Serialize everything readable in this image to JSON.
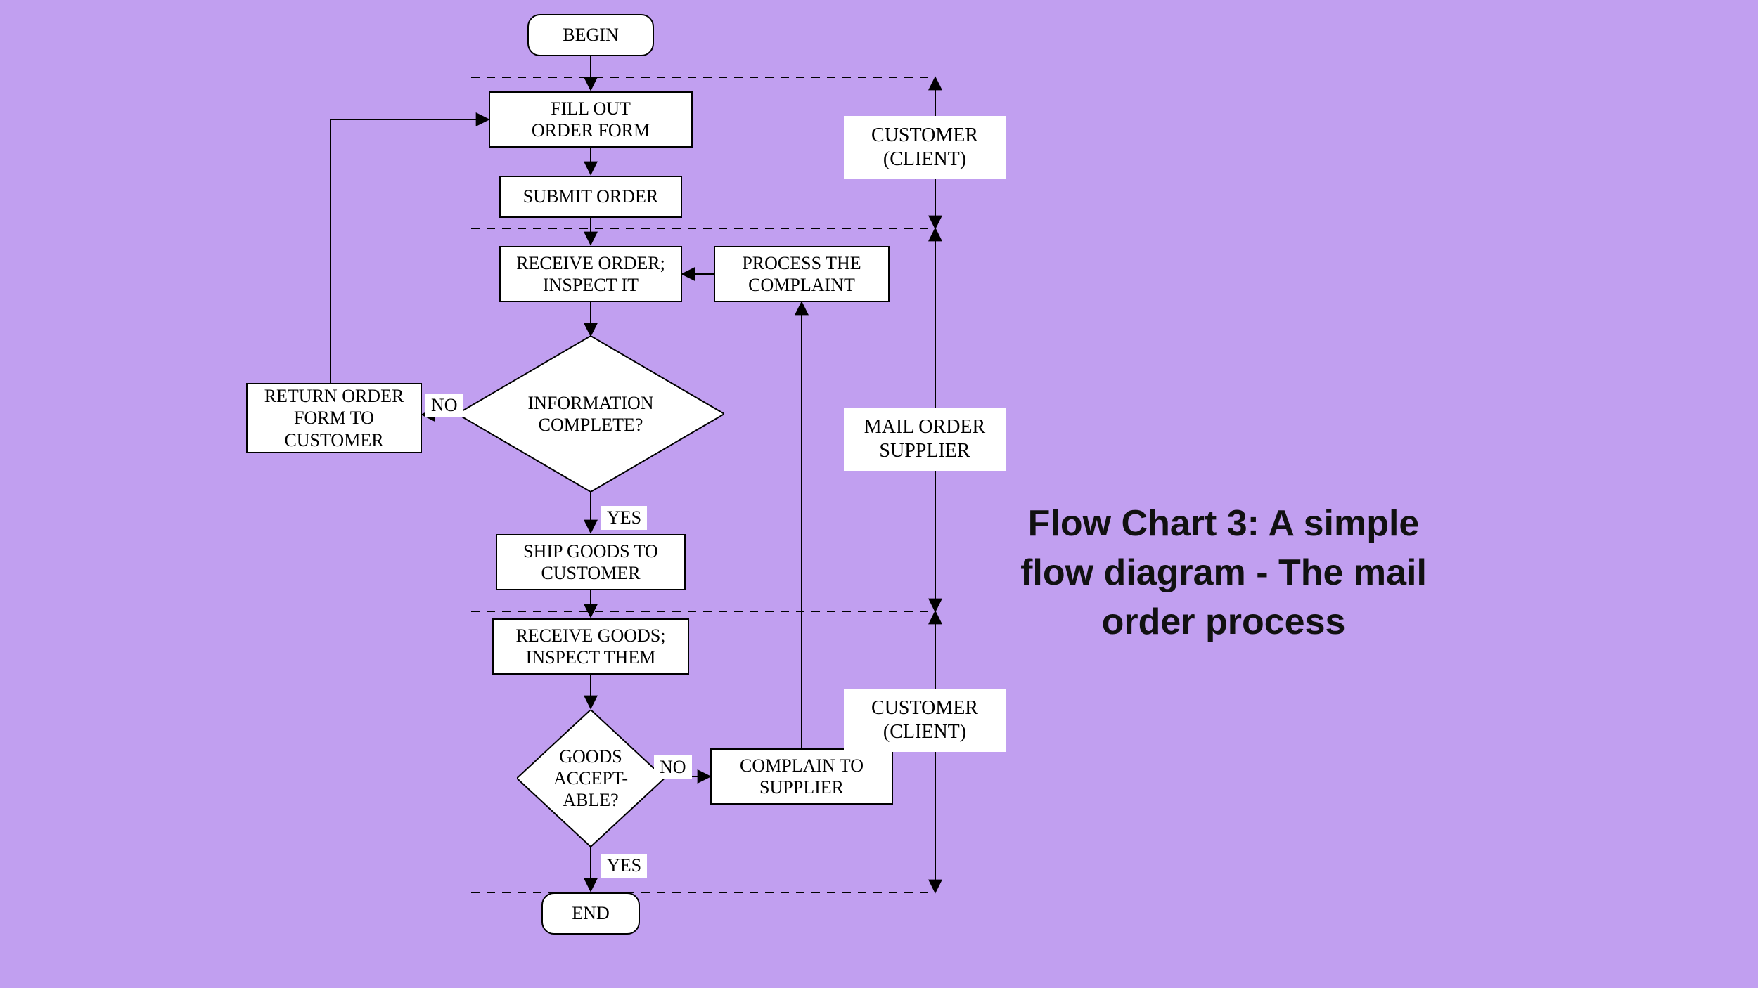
{
  "title": "Flow Chart 3:  A simple flow diagram - The mail order process",
  "nodes": {
    "begin": "BEGIN",
    "fill_out": "FILL OUT\nORDER FORM",
    "submit": "SUBMIT ORDER",
    "receive_order": "RECEIVE ORDER;\nINSPECT IT",
    "process_complaint": "PROCESS THE\nCOMPLAINT",
    "info_complete": "INFORMATION\nCOMPLETE?",
    "return_form": "RETURN ORDER\nFORM TO\nCUSTOMER",
    "ship_goods": "SHIP GOODS TO\nCUSTOMER",
    "receive_goods": "RECEIVE GOODS;\nINSPECT THEM",
    "goods_acceptable": "GOODS\nACCEPT-\nABLE?",
    "complain": "COMPLAIN TO\nSUPPLIER",
    "end": "END"
  },
  "labels": {
    "no1": "NO",
    "yes1": "YES",
    "no2": "NO",
    "yes2": "YES"
  },
  "swimlanes": {
    "customer1": "CUSTOMER\n(CLIENT)",
    "supplier": "MAIL ORDER\nSUPPLIER",
    "customer2": "CUSTOMER\n(CLIENT)"
  }
}
